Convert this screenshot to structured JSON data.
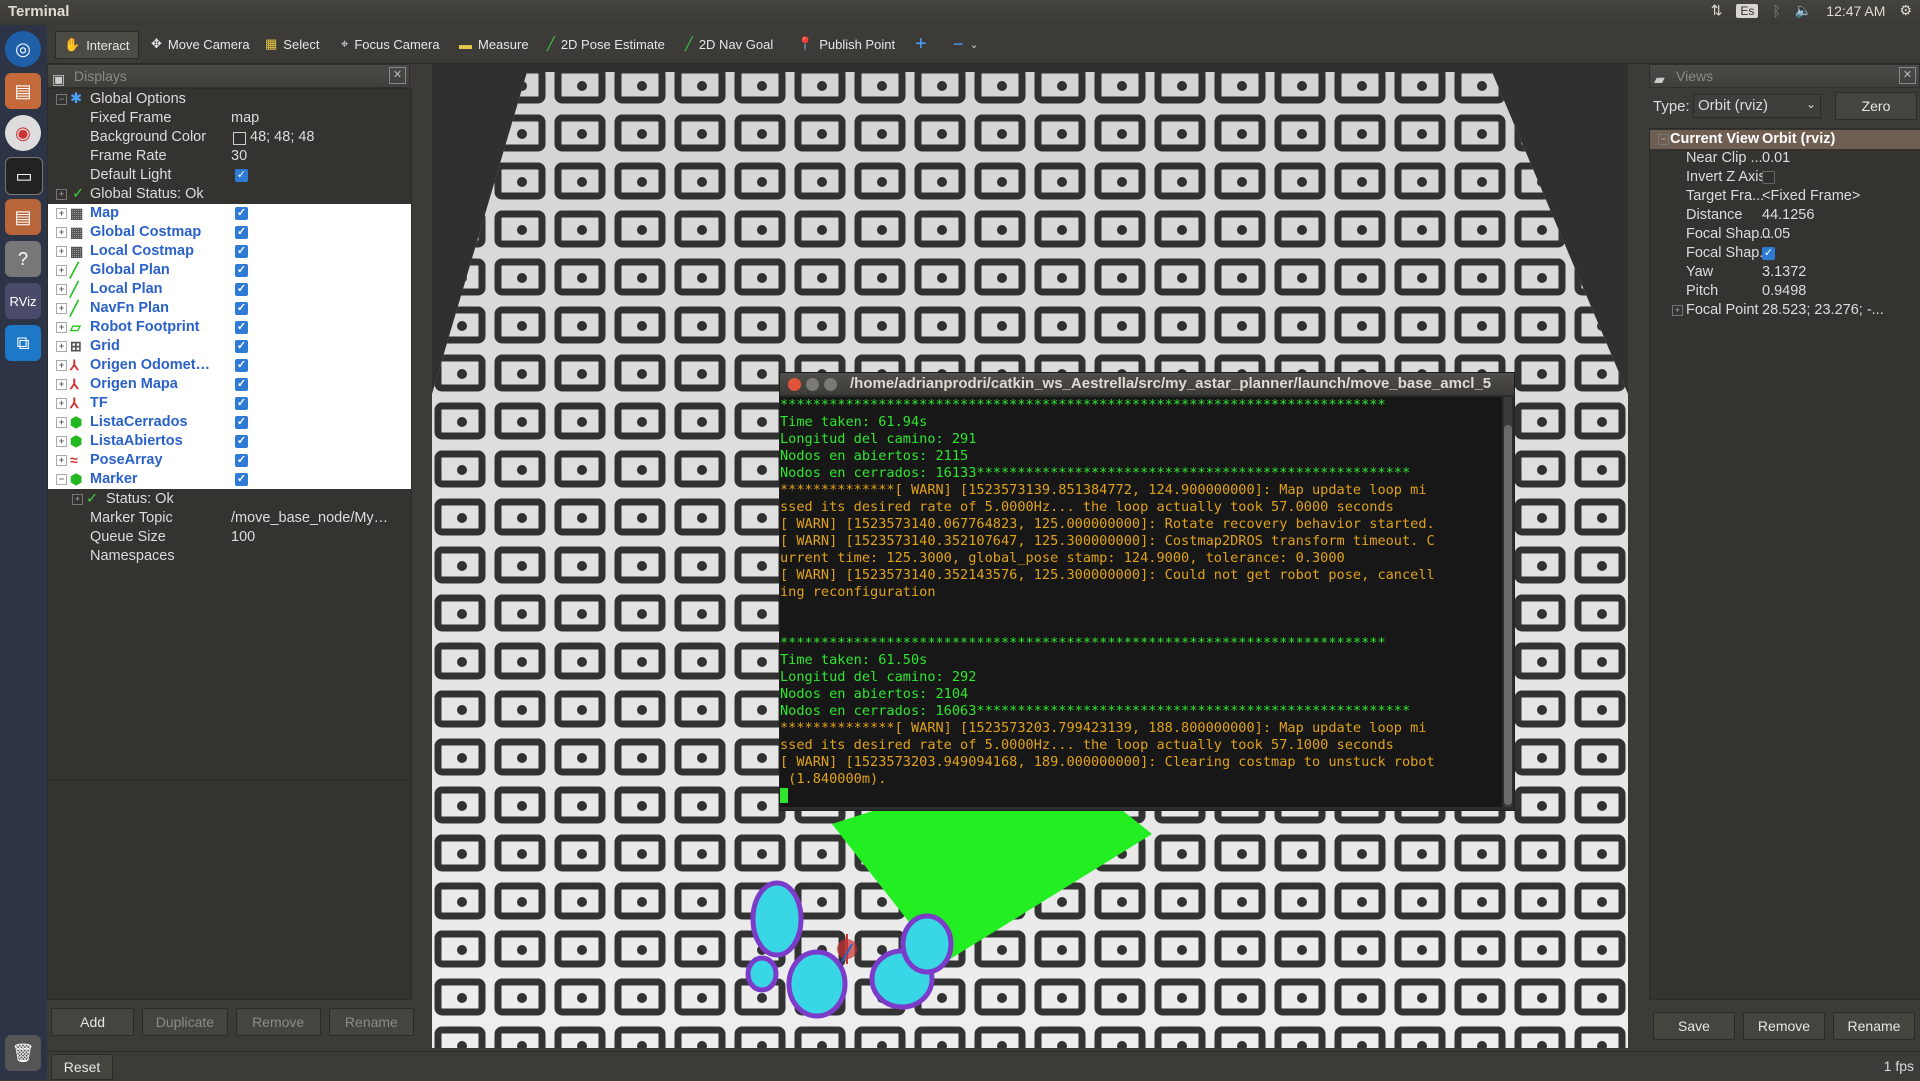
{
  "window_title": "Terminal",
  "tray": {
    "keyboard": "Es",
    "time": "12:47 AM"
  },
  "toolbar": {
    "interact": "Interact",
    "move_camera": "Move Camera",
    "select": "Select",
    "focus_camera": "Focus Camera",
    "measure": "Measure",
    "pose_estimate": "2D Pose Estimate",
    "nav_goal": "2D Nav Goal",
    "publish_point": "Publish Point",
    "plus": "+",
    "minus": "−"
  },
  "displays": {
    "title": "Displays",
    "global_options": "Global Options",
    "props": [
      {
        "name": "Fixed Frame",
        "value": "map"
      },
      {
        "name": "Background Color",
        "value": "48; 48; 48"
      },
      {
        "name": "Frame Rate",
        "value": "30"
      },
      {
        "name": "Default Light",
        "value": ""
      }
    ],
    "global_status": "Global Status: Ok",
    "items": [
      {
        "label": "Map",
        "icon": "map-icon"
      },
      {
        "label": "Global Costmap",
        "icon": "map-icon"
      },
      {
        "label": "Local Costmap",
        "icon": "map-icon"
      },
      {
        "label": "Global Plan",
        "icon": "path-icon"
      },
      {
        "label": "Local Plan",
        "icon": "path-icon"
      },
      {
        "label": "NavFn Plan",
        "icon": "path-icon"
      },
      {
        "label": "Robot Footprint",
        "icon": "polygon-icon"
      },
      {
        "label": "Grid",
        "icon": "grid-icon"
      },
      {
        "label": "Origen Odomet…",
        "icon": "axes-icon"
      },
      {
        "label": "Origen Mapa",
        "icon": "axes-icon"
      },
      {
        "label": "TF",
        "icon": "tf-icon"
      },
      {
        "label": "ListaCerrados",
        "icon": "marker-icon"
      },
      {
        "label": "ListaAbiertos",
        "icon": "marker-icon"
      },
      {
        "label": "PoseArray",
        "icon": "posearray-icon"
      },
      {
        "label": "Marker",
        "icon": "marker-icon"
      }
    ],
    "marker_status": "Status: Ok",
    "marker_props": [
      {
        "name": "Marker Topic",
        "value": "/move_base_node/My…"
      },
      {
        "name": "Queue Size",
        "value": "100"
      },
      {
        "name": "Namespaces",
        "value": ""
      }
    ],
    "buttons": {
      "add": "Add",
      "duplicate": "Duplicate",
      "remove": "Remove",
      "rename": "Rename"
    }
  },
  "views": {
    "title": "Views",
    "type_label": "Type:",
    "type_value": "Orbit (rviz)",
    "zero": "Zero",
    "current_view": "Current View",
    "current_view_type": "Orbit (rviz)",
    "props": [
      {
        "name": "Near Clip ...",
        "value": "0.01"
      },
      {
        "name": "Invert Z Axis",
        "value": ""
      },
      {
        "name": "Target Fra...",
        "value": "<Fixed Frame>"
      },
      {
        "name": "Distance",
        "value": "44.1256"
      },
      {
        "name": "Focal Shap...",
        "value": "0.05"
      },
      {
        "name": "Focal Shap...",
        "value": ""
      },
      {
        "name": "Yaw",
        "value": "3.1372"
      },
      {
        "name": "Pitch",
        "value": "0.9498"
      },
      {
        "name": "Focal Point",
        "value": "28.523; 23.276; -..."
      }
    ],
    "buttons": {
      "save": "Save",
      "remove": "Remove",
      "rename": "Rename"
    }
  },
  "terminal": {
    "title": "/home/adrianprodri/catkin_ws_Aestrella/src/my_astar_planner/launch/move_base_amcl_5",
    "lines": [
      {
        "c": "g",
        "t": "**************************************************************************"
      },
      {
        "c": "g",
        "t": "Time taken: 61.94s"
      },
      {
        "c": "g",
        "t": "Longitud del camino: 291"
      },
      {
        "c": "g",
        "t": "Nodos en abiertos: 2115"
      },
      {
        "c": "g",
        "t": "Nodos en cerrados: 16133*****************************************************"
      },
      {
        "c": "y",
        "t": "**************[ WARN] [1523573139.851384772, 124.900000000]: Map update loop mi"
      },
      {
        "c": "y",
        "t": "ssed its desired rate of 5.0000Hz... the loop actually took 57.0000 seconds"
      },
      {
        "c": "y",
        "t": "[ WARN] [1523573140.067764823, 125.000000000]: Rotate recovery behavior started."
      },
      {
        "c": "y",
        "t": "[ WARN] [1523573140.352107647, 125.300000000]: Costmap2DROS transform timeout. C"
      },
      {
        "c": "y",
        "t": "urrent time: 125.3000, global_pose stamp: 124.9000, tolerance: 0.3000"
      },
      {
        "c": "y",
        "t": "[ WARN] [1523573140.352143576, 125.300000000]: Could not get robot pose, cancell"
      },
      {
        "c": "y",
        "t": "ing reconfiguration"
      },
      {
        "c": "g",
        "t": ""
      },
      {
        "c": "g",
        "t": ""
      },
      {
        "c": "g",
        "t": "**************************************************************************"
      },
      {
        "c": "g",
        "t": "Time taken: 61.50s"
      },
      {
        "c": "g",
        "t": "Longitud del camino: 292"
      },
      {
        "c": "g",
        "t": "Nodos en abiertos: 2104"
      },
      {
        "c": "g",
        "t": "Nodos en cerrados: 16063*****************************************************"
      },
      {
        "c": "y",
        "t": "**************[ WARN] [1523573203.799423139, 188.800000000]: Map update loop mi"
      },
      {
        "c": "y",
        "t": "ssed its desired rate of 5.0000Hz... the loop actually took 57.1000 seconds"
      },
      {
        "c": "y",
        "t": "[ WARN] [1523573203.949094168, 189.000000000]: Clearing costmap to unstuck robot"
      },
      {
        "c": "y",
        "t": " (1.840000m)."
      }
    ]
  },
  "statusbar": {
    "reset": "Reset",
    "fps": "1 fps"
  },
  "colors": {
    "plan_green": "#22ee22",
    "costmap_cyan": "#39d6e6",
    "costmap_purple": "#7a3cc9",
    "selection_blue": "#2a62c9"
  }
}
